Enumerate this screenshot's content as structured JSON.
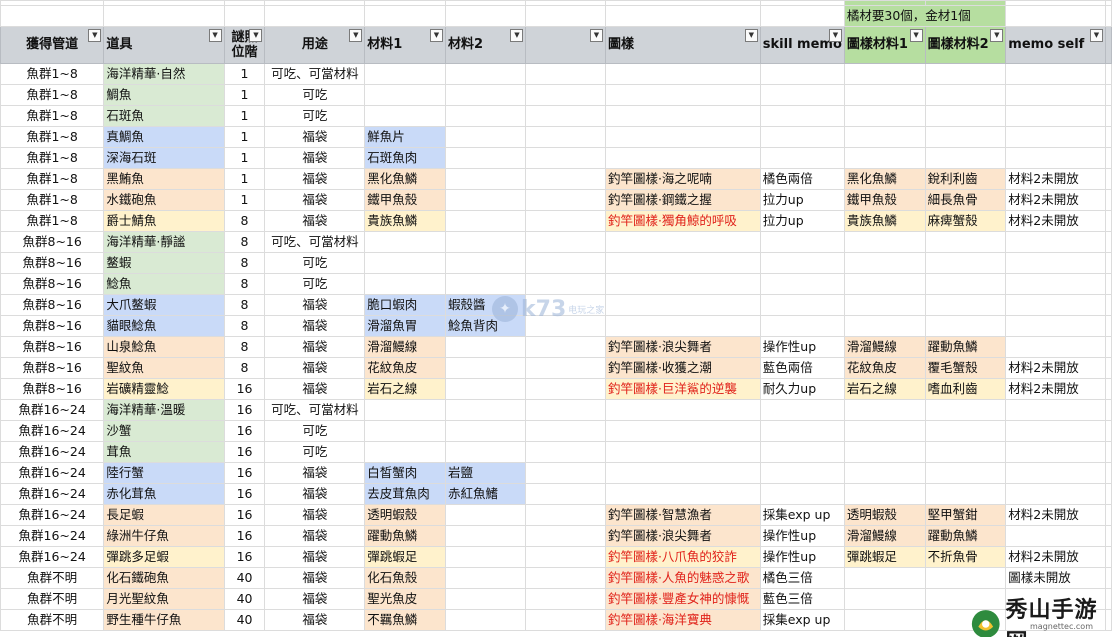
{
  "note": "橘材要30個，金材1個",
  "headers": [
    "獲得管道",
    "道具",
    "謎照位階",
    "用途",
    "材料1",
    "材料2",
    "",
    "圖樣",
    "skill memo",
    "圖樣材料1",
    "圖樣材料2",
    "memo self"
  ],
  "rows": [
    [
      "魚群1~8",
      "海洋精華·自然",
      "1",
      "可吃、可當材料",
      "",
      "",
      "",
      "",
      "",
      "",
      "",
      ""
    ],
    [
      "魚群1~8",
      "鯛魚",
      "1",
      "可吃",
      "",
      "",
      "",
      "",
      "",
      "",
      "",
      ""
    ],
    [
      "魚群1~8",
      "石斑魚",
      "1",
      "可吃",
      "",
      "",
      "",
      "",
      "",
      "",
      "",
      ""
    ],
    [
      "魚群1~8",
      "真鯛魚",
      "1",
      "福袋",
      "鮮魚片",
      "",
      "",
      "",
      "",
      "",
      "",
      ""
    ],
    [
      "魚群1~8",
      "深海石斑",
      "1",
      "福袋",
      "石斑魚肉",
      "",
      "",
      "",
      "",
      "",
      "",
      ""
    ],
    [
      "魚群1~8",
      "黑鮪魚",
      "1",
      "福袋",
      "黑化魚鱗",
      "",
      "",
      "釣竿圖樣·海之呢喃",
      "橘色兩倍",
      "黑化魚鱗",
      "銳利利齒",
      "材料2未開放"
    ],
    [
      "魚群1~8",
      "水鐵砲魚",
      "1",
      "福袋",
      "鐵甲魚殼",
      "",
      "",
      "釣竿圖樣·鋼鐵之握",
      "拉力up",
      "鐵甲魚殼",
      "細長魚骨",
      "材料2未開放"
    ],
    [
      "魚群1~8",
      "爵士鯖魚",
      "8",
      "福袋",
      "貴族魚鱗",
      "",
      "",
      "釣竿圖樣·獨角鯨的呼吸",
      "拉力up",
      "貴族魚鱗",
      "麻痺蟹殼",
      "材料2未開放"
    ],
    [
      "魚群8~16",
      "海洋精華·靜謐",
      "8",
      "可吃、可當材料",
      "",
      "",
      "",
      "",
      "",
      "",
      "",
      ""
    ],
    [
      "魚群8~16",
      "鳌蝦",
      "8",
      "可吃",
      "",
      "",
      "",
      "",
      "",
      "",
      "",
      ""
    ],
    [
      "魚群8~16",
      "鯰魚",
      "8",
      "可吃",
      "",
      "",
      "",
      "",
      "",
      "",
      "",
      ""
    ],
    [
      "魚群8~16",
      "大爪鳌蝦",
      "8",
      "福袋",
      "脆口蝦肉",
      "蝦殼醬",
      "",
      "",
      "",
      "",
      "",
      ""
    ],
    [
      "魚群8~16",
      "貓眼鯰魚",
      "8",
      "福袋",
      "滑溜魚胃",
      "鯰魚背肉",
      "",
      "",
      "",
      "",
      "",
      ""
    ],
    [
      "魚群8~16",
      "山泉鯰魚",
      "8",
      "福袋",
      "滑溜鰻線",
      "",
      "",
      "釣竿圖樣·浪尖舞者",
      "操作性up",
      "滑溜鰻線",
      "躍動魚鱗",
      ""
    ],
    [
      "魚群8~16",
      "聖紋魚",
      "8",
      "福袋",
      "花紋魚皮",
      "",
      "",
      "釣竿圖樣·收獲之潮",
      "藍色兩倍",
      "花紋魚皮",
      "覆毛蟹殼",
      "材料2未開放"
    ],
    [
      "魚群8~16",
      "岩礦精靈鯰",
      "16",
      "福袋",
      "岩石之線",
      "",
      "",
      "釣竿圖樣·巨洋鯊的逆襲",
      "耐久力up",
      "岩石之線",
      "嗜血利齒",
      "材料2未開放"
    ],
    [
      "魚群16~24",
      "海洋精華·溫暖",
      "16",
      "可吃、可當材料",
      "",
      "",
      "",
      "",
      "",
      "",
      "",
      ""
    ],
    [
      "魚群16~24",
      "沙蟹",
      "16",
      "可吃",
      "",
      "",
      "",
      "",
      "",
      "",
      "",
      ""
    ],
    [
      "魚群16~24",
      "茸魚",
      "16",
      "可吃",
      "",
      "",
      "",
      "",
      "",
      "",
      "",
      ""
    ],
    [
      "魚群16~24",
      "陸行蟹",
      "16",
      "福袋",
      "白皙蟹肉",
      "岩鹽",
      "",
      "",
      "",
      "",
      "",
      ""
    ],
    [
      "魚群16~24",
      "赤化茸魚",
      "16",
      "福袋",
      "去皮茸魚肉",
      "赤紅魚鰭",
      "",
      "",
      "",
      "",
      "",
      ""
    ],
    [
      "魚群16~24",
      "長足蝦",
      "16",
      "福袋",
      "透明蝦殼",
      "",
      "",
      "釣竿圖樣·智慧漁者",
      "採集exp up",
      "透明蝦殼",
      "堅甲蟹鉗",
      "材料2未開放"
    ],
    [
      "魚群16~24",
      "綠洲牛仔魚",
      "16",
      "福袋",
      "躍動魚鱗",
      "",
      "",
      "釣竿圖樣·浪尖舞者",
      "操作性up",
      "滑溜鰻線",
      "躍動魚鱗",
      ""
    ],
    [
      "魚群16~24",
      "彈跳多足蝦",
      "16",
      "福袋",
      "彈跳蝦足",
      "",
      "",
      "釣竿圖樣·八爪魚的狡詐",
      "操作性up",
      "彈跳蝦足",
      "不折魚骨",
      "材料2未開放"
    ],
    [
      "魚群不明",
      "化石鐵砲魚",
      "40",
      "福袋",
      "化石魚殼",
      "",
      "",
      "釣竿圖樣·人魚的魅惑之歌",
      "橘色三倍",
      "",
      "",
      "圖樣未開放"
    ],
    [
      "魚群不明",
      "月光聖紋魚",
      "40",
      "福袋",
      "聖光魚皮",
      "",
      "",
      "釣竿圖樣·豐產女神的慷慨",
      "藍色三倍",
      "",
      "",
      ""
    ],
    [
      "魚群不明",
      "野生種牛仔魚",
      "40",
      "福袋",
      "不羈魚鱗",
      "",
      "",
      "釣竿圖樣·海洋寶典",
      "採集exp up",
      "",
      "",
      ""
    ]
  ],
  "item_colors": [
    "green",
    "green",
    "green",
    "blue",
    "blue",
    "peach",
    "peach",
    "yellow",
    "green",
    "green",
    "green",
    "blue",
    "blue",
    "peach",
    "peach",
    "yellow",
    "green",
    "green",
    "green",
    "blue",
    "blue",
    "peach",
    "peach",
    "yellow",
    "peach",
    "peach",
    "peach"
  ],
  "pattern_red": [
    false,
    false,
    false,
    false,
    false,
    false,
    false,
    true,
    false,
    false,
    false,
    false,
    false,
    false,
    false,
    true,
    false,
    false,
    false,
    false,
    false,
    false,
    false,
    true,
    true,
    true,
    true
  ],
  "watermark": {
    "brand": "k73",
    "sub": "电玩之家",
    "site_name": "秀山手游网",
    "site_url": "magnettec.com"
  },
  "colors": {
    "header_bg": "#cfd3d8",
    "header_green": "#b6dea0",
    "green": "#d9ead3",
    "blue": "#c9daf8",
    "peach": "#fce5cd",
    "yellow": "#fff2cc",
    "red_text": "#e0221a"
  }
}
